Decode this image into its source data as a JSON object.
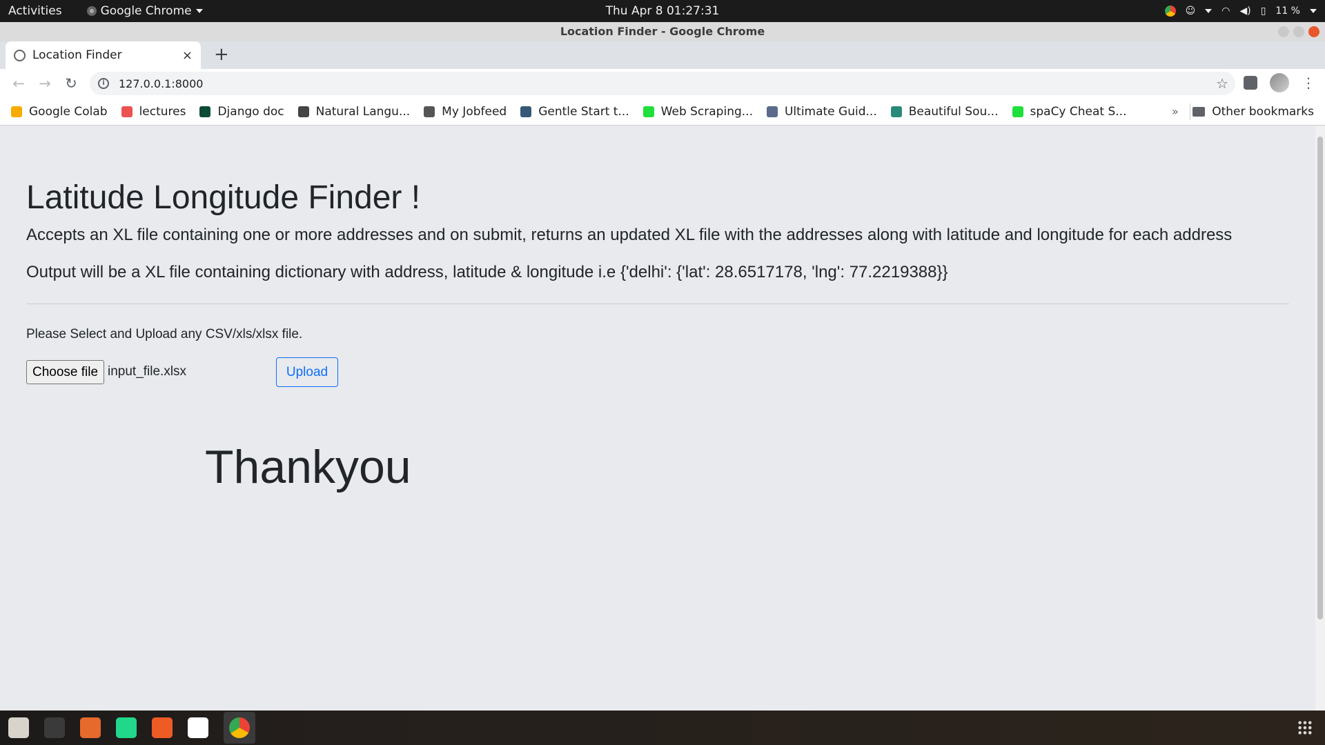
{
  "system": {
    "activities": "Activities",
    "app_menu": "Google Chrome",
    "clock": "Thu Apr 8  01:27:31",
    "battery": "11 %"
  },
  "window": {
    "title": "Location Finder - Google Chrome"
  },
  "tab": {
    "label": "Location Finder",
    "close": "×",
    "new_tab": "+"
  },
  "toolbar": {
    "url": "127.0.0.1:8000",
    "back": "←",
    "forward": "→",
    "reload": "↻",
    "star": "☆",
    "menu": "⋮"
  },
  "bookmarks": {
    "items": [
      {
        "label": "Google Colab",
        "icon": "colab-icon",
        "color": "#f9ab00"
      },
      {
        "label": "lectures",
        "icon": "udemy-icon",
        "color": "#ec5252"
      },
      {
        "label": "Django doc",
        "icon": "django-icon",
        "color": "#0c4b33"
      },
      {
        "label": "Natural Langu...",
        "icon": "globe-icon",
        "color": "#444444"
      },
      {
        "label": "My Jobfeed",
        "icon": "jobfeed-icon",
        "color": "#555555"
      },
      {
        "label": "Gentle Start t...",
        "icon": "tds-icon",
        "color": "#355876"
      },
      {
        "label": "Web Scraping...",
        "icon": "realpython-icon",
        "color": "#1fdf3c"
      },
      {
        "label": "Ultimate Guid...",
        "icon": "chart-icon",
        "color": "#5b6b8c"
      },
      {
        "label": "Beautiful Sou...",
        "icon": "c-icon",
        "color": "#2a8a7a"
      },
      {
        "label": "spaCy Cheat S...",
        "icon": "realpython-icon",
        "color": "#1fdf3c"
      }
    ],
    "more": "»",
    "other": "Other bookmarks"
  },
  "page": {
    "heading": "Latitude Longitude Finder !",
    "lead1": "Accepts an XL file containing one or more addresses and on submit, returns an updated XL file with the addresses along with latitude and longitude for each address",
    "lead2": "Output will be a XL file containing dictionary with address, latitude & longitude i.e {'delhi': {'lat': 28.6517178, 'lng': 77.2219388}}",
    "upload_label": "Please Select and Upload any CSV/xls/xlsx file.",
    "choose_file": "Choose file",
    "file_name": "input_file.xlsx",
    "upload_button": "Upload",
    "thanks": "Thankyou"
  },
  "dock": {
    "apps": [
      {
        "name": "files-icon",
        "color": "#d8d4cc"
      },
      {
        "name": "terminal-icon",
        "color": "#3a3a3a"
      },
      {
        "name": "ubuntu-software-icon",
        "color": "#e66a2c"
      },
      {
        "name": "pycharm-icon",
        "color": "#21d789"
      },
      {
        "name": "postman-icon",
        "color": "#ef5b25"
      },
      {
        "name": "text-editor-icon",
        "color": "#ffffff"
      }
    ]
  }
}
